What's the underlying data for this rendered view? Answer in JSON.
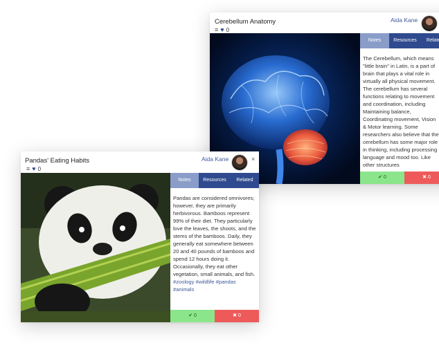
{
  "cards": [
    {
      "title": "Cerebellum Anatomy",
      "author": "Aida Kane",
      "likes": "0",
      "tabs": [
        "Notes",
        "Resources",
        "Related"
      ],
      "text": "The Cerebellum, which means \"little brain\" in Latin, is a part of brain that plays a vital role in virtually all physical movement. The cerebellum has several functions relating to movement and coordination, including Maintaining balance, Coordinating movement, Vision & Motor learning. Some researchers also believe that the cerebellum has some major role in thinking, including processing language and mood too. Like other structures",
      "tags": "",
      "like_count": "0",
      "dislike_count": "0",
      "icons": {
        "like": "check-icon",
        "dislike": "x-icon"
      }
    },
    {
      "title": "Pandas' Eating Habits",
      "author": "Aida Kane",
      "likes": "0",
      "close": "×",
      "tabs": [
        "Notes",
        "Resources",
        "Related"
      ],
      "text": "Pandas are considered omnivores; however, they are primarily herbivorous. Bamboos represent 99% of their diet. They particularly love the leaves, the shoots, and the stems of the bamboos. Daily, they generally eat somewhere between 20 and 40 pounds of bamboos and spend 12 hours doing it. Occasionally, they eat other vegetation, small animals, and fish.",
      "tags": "#zoology #wildlife #pandas #animals",
      "like_count": "0",
      "dislike_count": "0"
    }
  ],
  "colors": {
    "tab": "#2f4a8e",
    "tab_active": "#8a9dc9",
    "like": "#8be58b",
    "dislike": "#ee5a5a",
    "link": "#3d5a99"
  }
}
